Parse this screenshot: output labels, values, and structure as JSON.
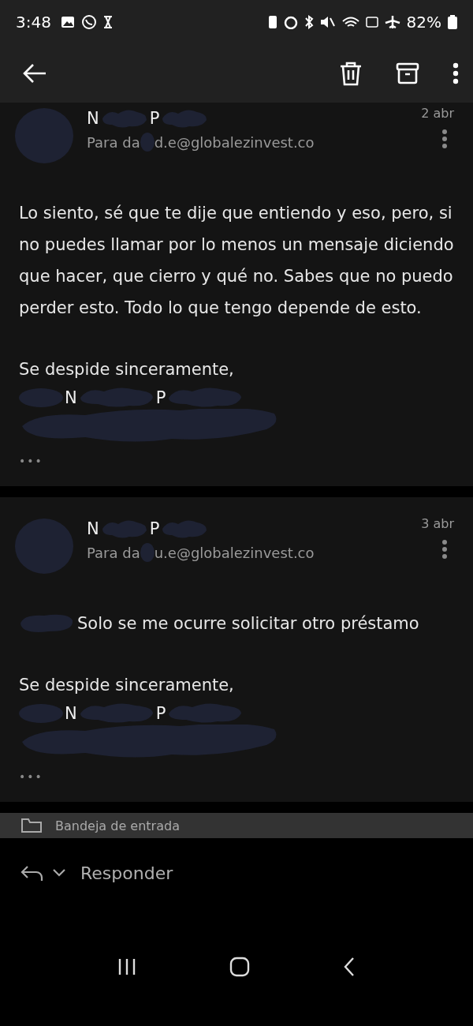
{
  "status_bar": {
    "time": "3:48",
    "battery": "82%"
  },
  "messages": [
    {
      "sender": [
        "N",
        "P"
      ],
      "recipient_prefix": "Para da",
      "recipient_suffix": "d.e@globalezinvest.co",
      "date": "2 abr",
      "body_redacted_prefix": false,
      "body": [
        "Lo siento, sé que te dije que entiendo y eso, pero, si no puedes llamar por lo menos un mensaje diciendo que hacer, que cierro y qué no. Sabes que no puedo perder esto. Todo lo que tengo depende de esto."
      ],
      "closing": "Se despide sinceramente,",
      "signature": [
        "N",
        "P"
      ],
      "more": "•••"
    },
    {
      "sender": [
        "N",
        "P"
      ],
      "recipient_prefix": "Para da",
      "recipient_suffix": "u.e@globalezinvest.co",
      "date": "3 abr",
      "body_redacted_prefix": true,
      "body": [
        "Solo se me ocurre solicitar otro préstamo"
      ],
      "closing": "Se despide sinceramente,",
      "signature": [
        "N",
        "P"
      ],
      "more": "•••"
    }
  ],
  "folder": "Bandeja de entrada",
  "reply": {
    "label": "Responder"
  }
}
